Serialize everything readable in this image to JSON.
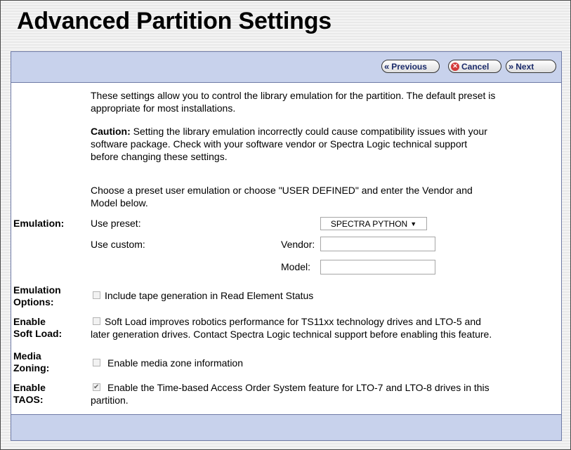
{
  "page": {
    "title": "Advanced Partition Settings"
  },
  "nav": {
    "previous_label": "Previous",
    "cancel_label": "Cancel",
    "next_label": "Next"
  },
  "intro": {
    "line1": "These settings allow you to control the library emulation for the partition. The default preset is",
    "line2": "appropriate for most installations.",
    "caution_label": "Caution:",
    "caution_line1": " Setting the library emulation incorrectly could cause compatibility issues with your",
    "caution_line2": "software package. Check with your software vendor or Spectra Logic technical support",
    "caution_line3": "before changing these settings.",
    "choose_line1": "Choose a preset user emulation or choose \"USER DEFINED\" and enter the Vendor and",
    "choose_line2": "Model below."
  },
  "emulation": {
    "label": "Emulation:",
    "preset_label": "Use preset:",
    "preset_value": "SPECTRA PYTHON",
    "custom_label": "Use custom:",
    "vendor_label": "Vendor:",
    "vendor_value": "",
    "model_label": "Model:",
    "model_value": ""
  },
  "emulation_options": {
    "label_line1": "Emulation",
    "label_line2": "Options:",
    "checkbox_label": "Include tape generation in Read Element Status",
    "checked": false
  },
  "soft_load": {
    "label_line1": "Enable",
    "label_line2": "Soft Load:",
    "text_line1": "Soft Load improves robotics performance for TS11xx technology drives and LTO-5 and",
    "text_line2": "later generation drives. Contact Spectra Logic technical support before enabling this feature.",
    "checked": false
  },
  "media_zoning": {
    "label_line1": "Media",
    "label_line2": "Zoning:",
    "checkbox_label": "Enable media zone information",
    "checked": false
  },
  "taos": {
    "label_line1": "Enable",
    "label_line2": "TAOS:",
    "text_line1": "Enable the Time-based Access Order System feature for LTO-7 and LTO-8 drives in this",
    "text_line2": "partition.",
    "checked": true
  },
  "icons": {
    "previous": "double-chevron-left-icon",
    "cancel": "cancel-circle-icon",
    "next": "double-chevron-right-icon"
  }
}
